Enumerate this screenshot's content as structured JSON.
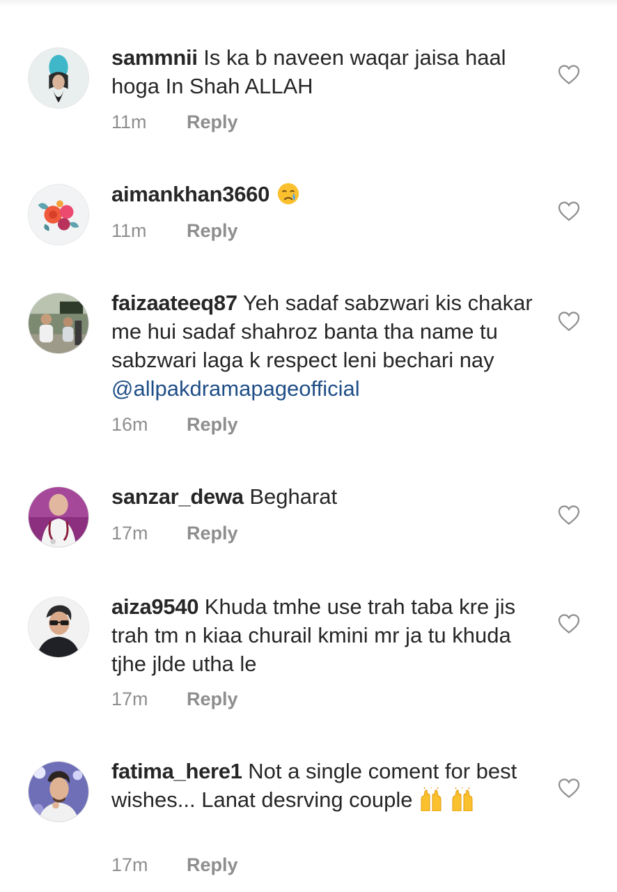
{
  "comments": [
    {
      "username": "sammnii",
      "text": "Is ka b naveen waqar jaisa haal hoga In Shah ALLAH",
      "time": "11m",
      "reply_label": "Reply",
      "avatar_icon": "woman-portrait-avatar"
    },
    {
      "username": "aimankhan3660",
      "text": "",
      "emoji": "crying-face",
      "time": "11m",
      "reply_label": "Reply",
      "avatar_icon": "flower-bouquet-avatar"
    },
    {
      "username": "faizaateeq87",
      "text": "Yeh sadaf sabzwari kis chakar me hui sadaf shahroz banta tha name tu sabzwari laga k respect leni bechari nay",
      "mention": "@allpakdramapageofficial",
      "time": "16m",
      "reply_label": "Reply",
      "avatar_icon": "children-outdoor-avatar"
    },
    {
      "username": "sanzar_dewa",
      "text": "Begharat",
      "time": "17m",
      "reply_label": "Reply",
      "avatar_icon": "doctor-stethoscope-avatar"
    },
    {
      "username": "aiza9540",
      "text": "Khuda tmhe use trah taba kre jis trah tm n kiaa churail kmini mr ja tu khuda tjhe jlde utha le",
      "time": "17m",
      "reply_label": "Reply",
      "avatar_icon": "man-sunglasses-avatar"
    },
    {
      "username": "fatima_here1",
      "text": "Not a single coment for best wishes... Lanat desrving couple",
      "emoji": "raising-hands",
      "time": "17m",
      "reply_label": "Reply",
      "avatar_icon": "man-portrait-avatar"
    }
  ],
  "colors": {
    "text": "#262626",
    "meta": "#8e8e8e",
    "mention": "#1f4e87",
    "heart_outline": "#8e8e8e"
  },
  "icons": {
    "like": "heart-outline-icon"
  }
}
